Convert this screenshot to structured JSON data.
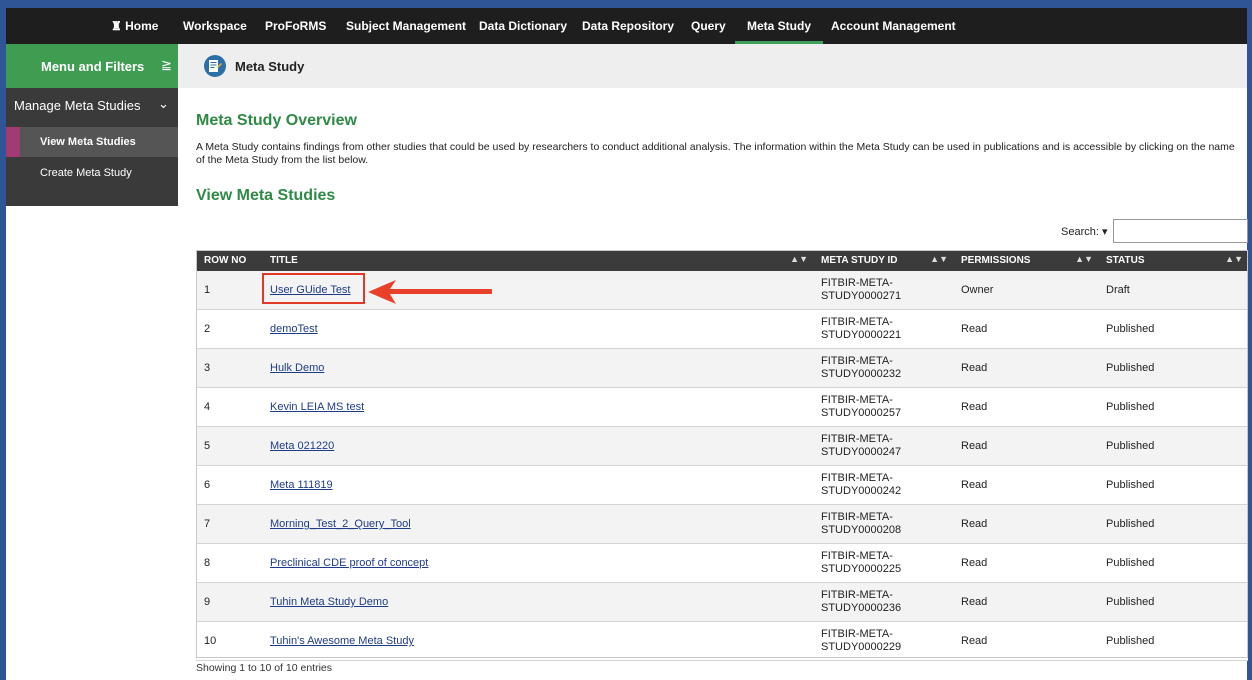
{
  "colors": {
    "brand_green": "#3f9d52",
    "nav_bg": "#1e1e1e",
    "header_green": "#2f8a45",
    "highlight": "#e03a26",
    "frame": "#2f5597"
  },
  "topnav": {
    "home": "Home",
    "items": [
      "Workspace",
      "ProFoRMS",
      "Subject Management",
      "Data Dictionary",
      "Data Repository",
      "Query",
      "Meta Study",
      "Account Management"
    ],
    "active": "Meta Study"
  },
  "sidebar": {
    "header": "Menu and Filters",
    "group": "Manage Meta Studies",
    "items": [
      "View Meta Studies",
      "Create Meta Study"
    ],
    "active": "View Meta Studies"
  },
  "breadcrumb": {
    "icon": "meta-study-icon",
    "title": "Meta Study"
  },
  "overview": {
    "title": "Meta Study Overview",
    "description": "A Meta Study contains findings from other studies that could be used by researchers to conduct additional analysis. The information within the Meta Study can be used in publications and is accessible by clicking on the name of the Meta Study from the list below."
  },
  "list": {
    "title": "View Meta Studies",
    "search_label": "Search:",
    "search_value": "",
    "columns": [
      "ROW NO",
      "TITLE",
      "META STUDY ID",
      "PERMISSIONS",
      "STATUS"
    ],
    "rows": [
      {
        "no": "1",
        "title": "User GUide Test",
        "id": "FITBIR-META-STUDY0000271",
        "perm": "Owner",
        "status": "Draft"
      },
      {
        "no": "2",
        "title": "demoTest",
        "id": "FITBIR-META-STUDY0000221",
        "perm": "Read",
        "status": "Published"
      },
      {
        "no": "3",
        "title": "Hulk Demo",
        "id": "FITBIR-META-STUDY0000232",
        "perm": "Read",
        "status": "Published"
      },
      {
        "no": "4",
        "title": "Kevin LEIA MS test",
        "id": "FITBIR-META-STUDY0000257",
        "perm": "Read",
        "status": "Published"
      },
      {
        "no": "5",
        "title": "Meta 021220",
        "id": "FITBIR-META-STUDY0000247",
        "perm": "Read",
        "status": "Published"
      },
      {
        "no": "6",
        "title": "Meta 111819",
        "id": "FITBIR-META-STUDY0000242",
        "perm": "Read",
        "status": "Published"
      },
      {
        "no": "7",
        "title": "Morning_Test_2_Query_Tool",
        "id": "FITBIR-META-STUDY0000208",
        "perm": "Read",
        "status": "Published"
      },
      {
        "no": "8",
        "title": "Preclinical CDE proof of concept",
        "id": "FITBIR-META-STUDY0000225",
        "perm": "Read",
        "status": "Published"
      },
      {
        "no": "9",
        "title": "Tuhin Meta Study Demo",
        "id": "FITBIR-META-STUDY0000236",
        "perm": "Read",
        "status": "Published"
      },
      {
        "no": "10",
        "title": "Tuhin's Awesome Meta Study",
        "id": "FITBIR-META-STUDY0000229",
        "perm": "Read",
        "status": "Published"
      }
    ],
    "footer": "Showing 1 to 10 of 10 entries"
  }
}
